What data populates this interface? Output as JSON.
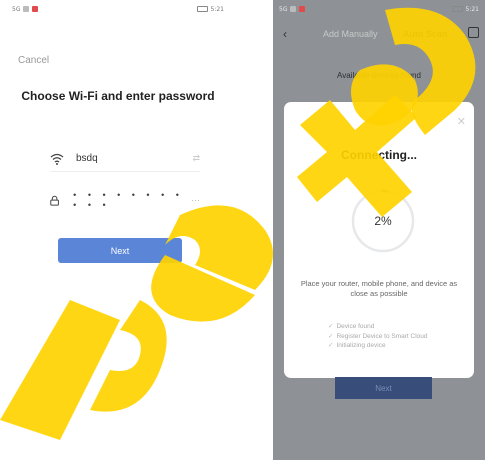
{
  "left_screen": {
    "status_bar": {
      "left": "5G",
      "right": "5:21"
    },
    "cancel_label": "Cancel",
    "title": "Choose Wi-Fi and enter password",
    "wifi_ssid": "bsdq",
    "password_mask": "• • • • • • • • • • •",
    "next_label": "Next"
  },
  "right_screen": {
    "status_bar": {
      "left": "5G",
      "right": "5:21"
    },
    "tabs": {
      "manual": "Add Manually",
      "scan": "Auto Scan"
    },
    "available_label": "Available devices found",
    "dialog": {
      "title": "Connecting...",
      "progress_text": "2%",
      "progress_value": 0.02,
      "hint": "Place your router, mobile phone, and device as close as possible",
      "steps": [
        {
          "label": "Device found",
          "done": true
        },
        {
          "label": "Register Device to Smart Cloud",
          "done": true
        },
        {
          "label": "Initializing device",
          "done": true
        }
      ]
    },
    "next_label": "Next"
  },
  "watermark_text": "beta",
  "colors": {
    "primary_button": "#5b85d6",
    "overlay": "#8e9296",
    "watermark": "#ffd200",
    "progress_arc": "#9aa0a6"
  },
  "icons": [
    "wifi-icon",
    "switch-wifi-icon",
    "lock-icon",
    "eye-icon",
    "back-icon",
    "scan-icon",
    "close-icon",
    "check-icon"
  ]
}
